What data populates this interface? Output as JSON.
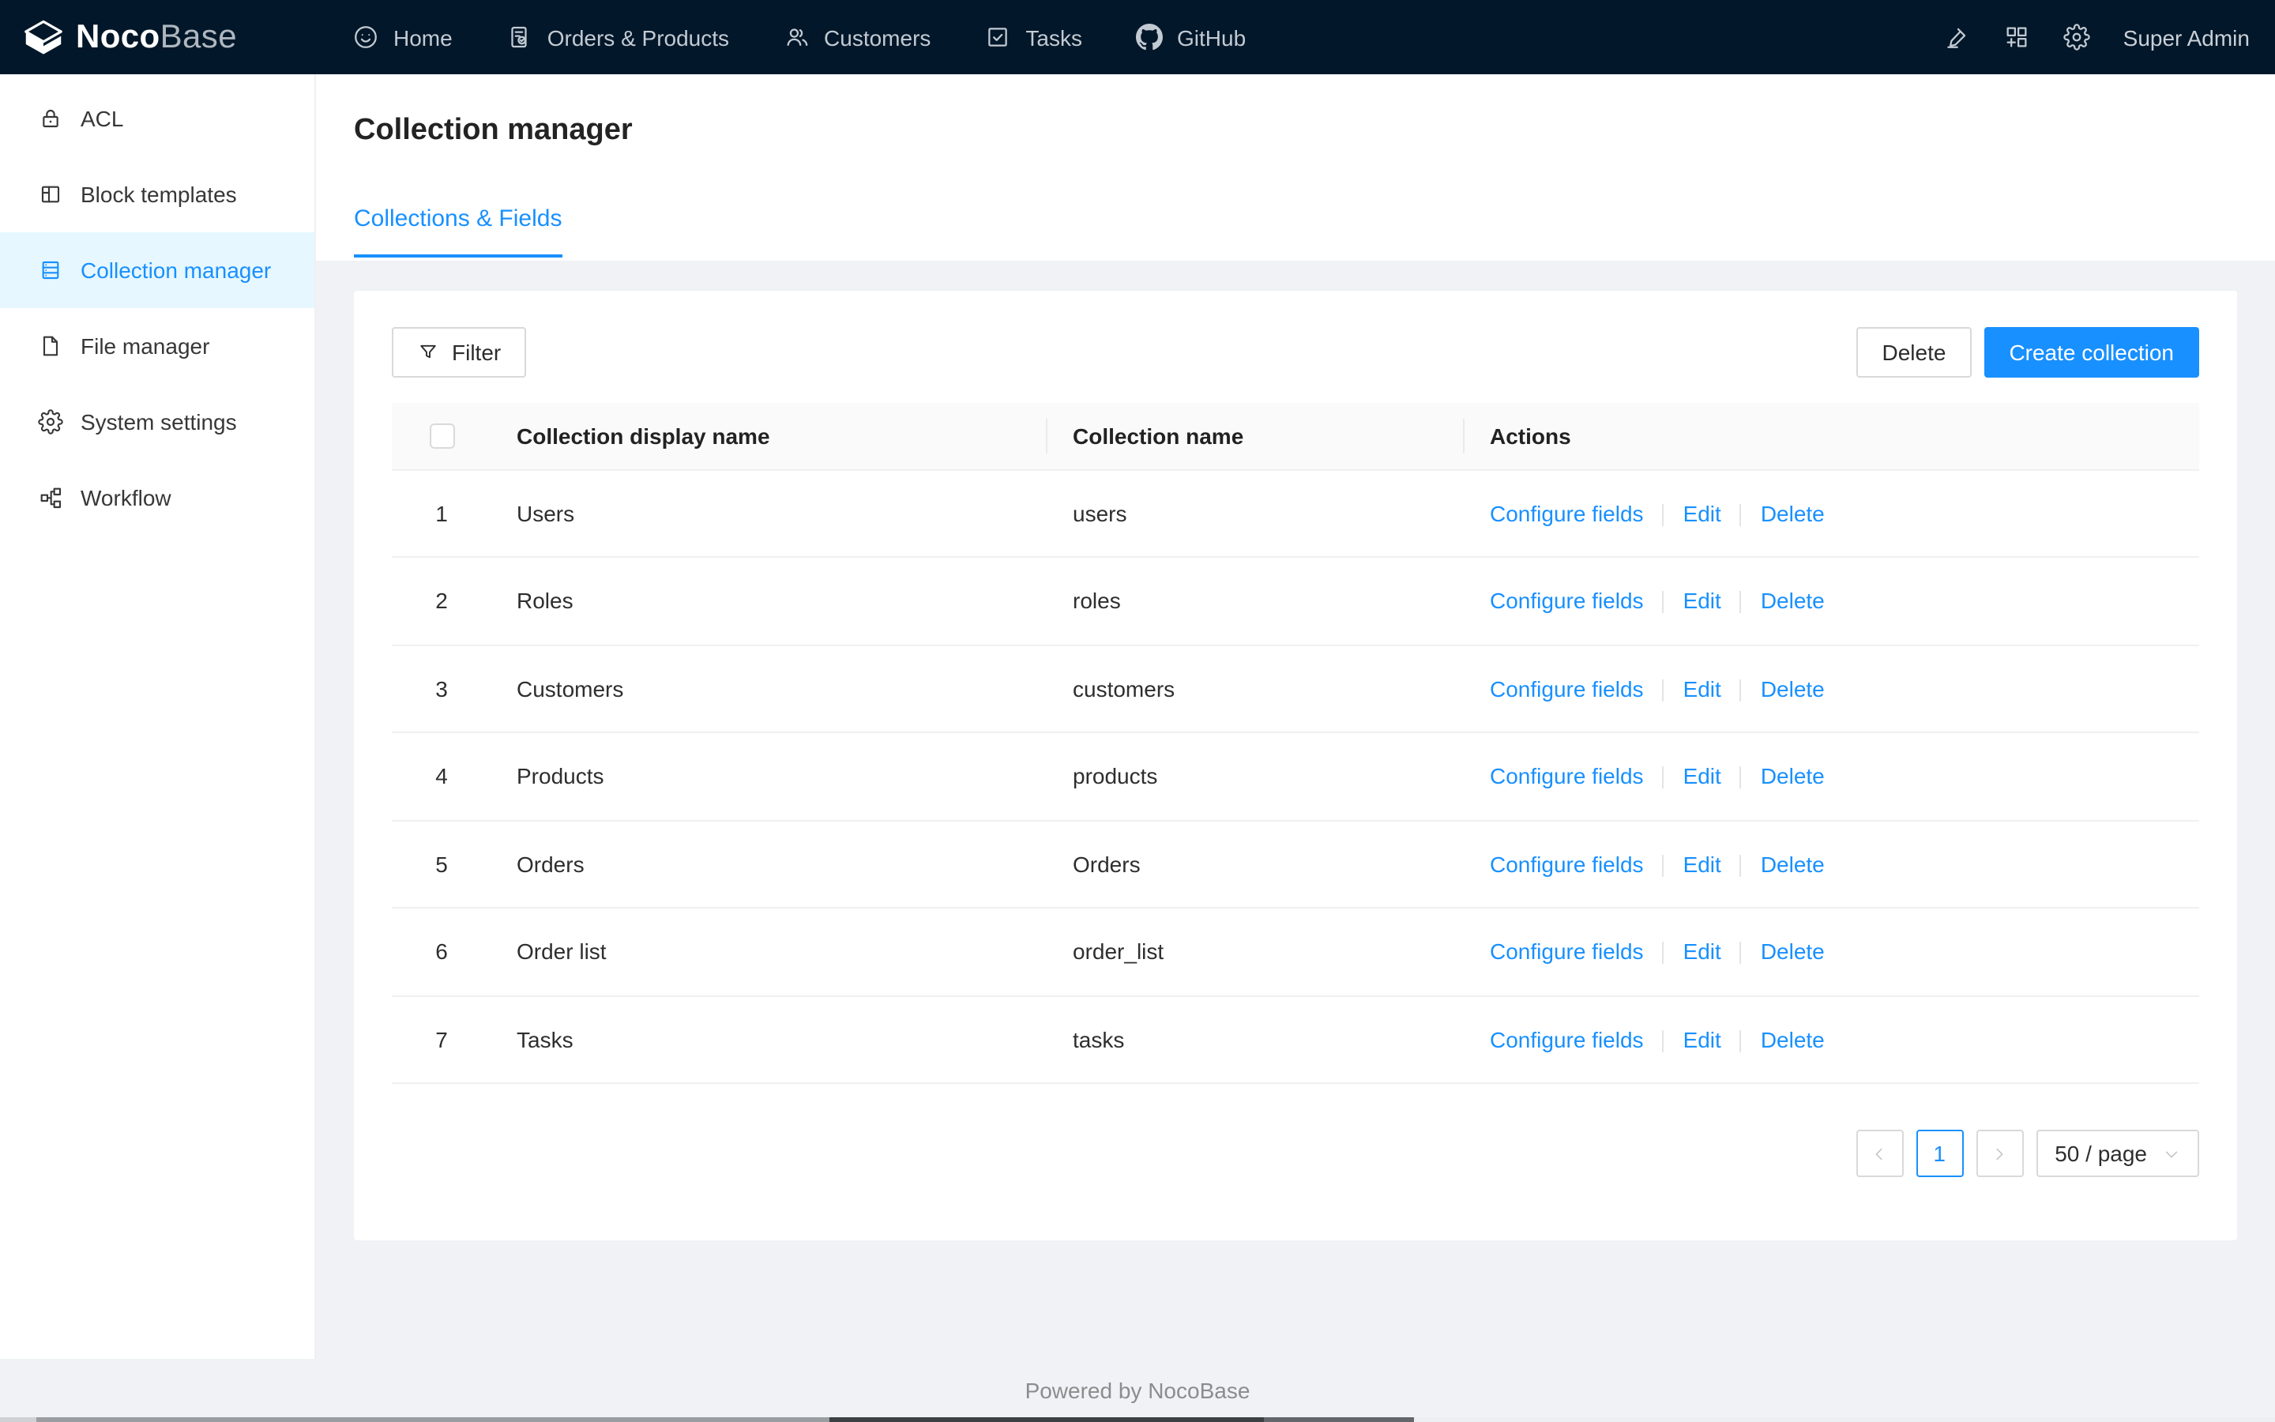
{
  "navbar": {
    "brand": {
      "noco": "Noco",
      "base": "Base"
    },
    "items": [
      {
        "label": "Home",
        "icon": "smile-icon"
      },
      {
        "label": "Orders & Products",
        "icon": "orders-icon"
      },
      {
        "label": "Customers",
        "icon": "team-icon"
      },
      {
        "label": "Tasks",
        "icon": "check-square-icon"
      },
      {
        "label": "GitHub",
        "icon": "github-icon"
      }
    ],
    "user": "Super Admin"
  },
  "sidebar": {
    "active_index": 2,
    "items": [
      {
        "label": "ACL",
        "icon": "lock-icon"
      },
      {
        "label": "Block templates",
        "icon": "layout-icon"
      },
      {
        "label": "Collection manager",
        "icon": "database-icon"
      },
      {
        "label": "File manager",
        "icon": "file-icon"
      },
      {
        "label": "System settings",
        "icon": "gear-icon"
      },
      {
        "label": "Workflow",
        "icon": "partition-icon"
      }
    ]
  },
  "page": {
    "title": "Collection manager",
    "tabs": [
      {
        "label": "Collections & Fields",
        "active": true
      }
    ]
  },
  "toolbar": {
    "filter_label": "Filter",
    "delete_label": "Delete",
    "create_label": "Create collection"
  },
  "table": {
    "columns": [
      "Collection display name",
      "Collection name",
      "Actions"
    ],
    "action_labels": [
      "Configure fields",
      "Edit",
      "Delete"
    ],
    "rows": [
      {
        "index": "1",
        "display_name": "Users",
        "name": "users"
      },
      {
        "index": "2",
        "display_name": "Roles",
        "name": "roles"
      },
      {
        "index": "3",
        "display_name": "Customers",
        "name": "customers"
      },
      {
        "index": "4",
        "display_name": "Products",
        "name": "products"
      },
      {
        "index": "5",
        "display_name": "Orders",
        "name": "Orders"
      },
      {
        "index": "6",
        "display_name": "Order list",
        "name": "order_list"
      },
      {
        "index": "7",
        "display_name": "Tasks",
        "name": "tasks"
      }
    ]
  },
  "pagination": {
    "current": "1",
    "page_size_label": "50 / page"
  },
  "footer": {
    "text": "Powered by NocoBase"
  },
  "colors": {
    "accent": "#1890ff",
    "navbar_bg": "#021729",
    "selected_bg": "#e6f7ff",
    "page_bg": "#f0f2f5"
  }
}
